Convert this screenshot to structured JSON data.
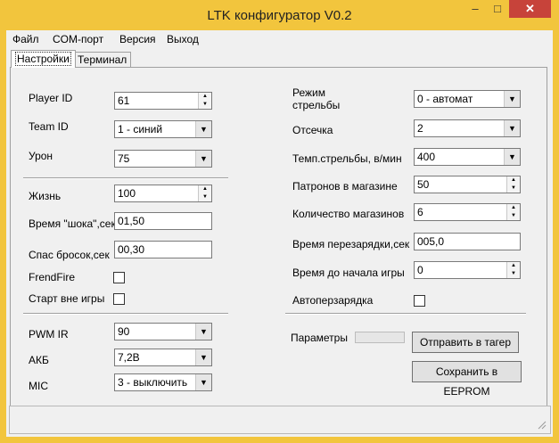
{
  "window": {
    "title": "LTK конфигуратор V0.2",
    "minimize": "–",
    "maximize": "□",
    "close": "✕"
  },
  "menu": [
    "Файл",
    "COM-порт",
    "Версия",
    "Выход"
  ],
  "tabs": [
    "Настройки",
    "Терминал"
  ],
  "left": {
    "player_id": {
      "label": "Player ID",
      "value": "61"
    },
    "team_id": {
      "label": "Team ID",
      "value": "1 - синий"
    },
    "damage": {
      "label": "Урон",
      "value": "75"
    },
    "life": {
      "label": "Жизнь",
      "value": "100"
    },
    "shock_time": {
      "label": "Время \"шока\",сек",
      "value": "01,50"
    },
    "respawn": {
      "label": "Спас бросок,сек",
      "value": "00,30"
    },
    "friendfire": {
      "label": "FrendFire",
      "checked": false
    },
    "start_outside": {
      "label": "Старт вне игры",
      "checked": false
    },
    "pwm_ir": {
      "label": "PWM IR",
      "value": "90"
    },
    "akb": {
      "label": "АКБ",
      "value": "7,2В"
    },
    "mic": {
      "label": "MIC",
      "value": "3 - выключить"
    }
  },
  "right": {
    "fire_mode": {
      "label": "Режим\nстрельбы",
      "value": "0 - автомат"
    },
    "cutoff": {
      "label": "Отсечка",
      "value": "2"
    },
    "rate": {
      "label": "Темп.стрельбы, в/мин",
      "value": "400"
    },
    "ammo": {
      "label": "Патронов в магазине",
      "value": "50"
    },
    "mags": {
      "label": "Количество магазинов",
      "value": "6"
    },
    "reload": {
      "label": "Время перезарядки,сек",
      "value": "005,0"
    },
    "pregame": {
      "label": "Время до начала игры",
      "value": "0"
    },
    "autoreload": {
      "label": "Автоперзарядка",
      "checked": false
    }
  },
  "params": {
    "label": "Параметры",
    "progress": 0
  },
  "buttons": {
    "send": "Отправить в тагер",
    "save": "Сохранить в EEPROM"
  },
  "icons": {
    "dropdown": "chevron-down-icon",
    "spin_up": "triangle-up-icon",
    "spin_down": "triangle-down-icon"
  }
}
